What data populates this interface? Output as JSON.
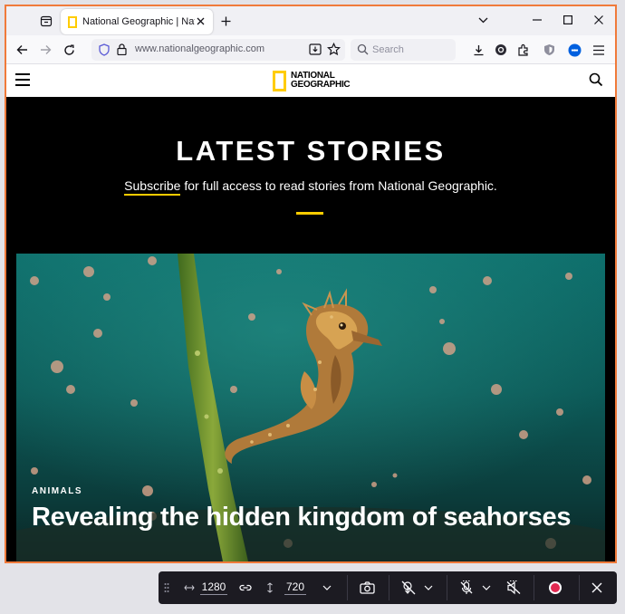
{
  "browser": {
    "tab": {
      "title": "National Geographic | National Geographic"
    },
    "urlbar": {
      "url": "www.nationalgeographic.com"
    },
    "searchbar": {
      "placeholder": "Search"
    }
  },
  "site": {
    "logo_line1": "NATIONAL",
    "logo_line2": "GEOGRAPHIC",
    "hero_title": "LATEST STORIES",
    "hero_sub_link": "Subscribe",
    "hero_sub_rest": " for full access to read stories from National Geographic.",
    "story": {
      "category": "ANIMALS",
      "title": "Revealing the hidden kingdom of seahorses"
    }
  },
  "devtools": {
    "width": "1280",
    "height": "720"
  },
  "colors": {
    "accent": "#ffcc00",
    "frame_border": "#f07a3a",
    "toolbar_bg": "#1c1b22",
    "record": "#e22850"
  }
}
